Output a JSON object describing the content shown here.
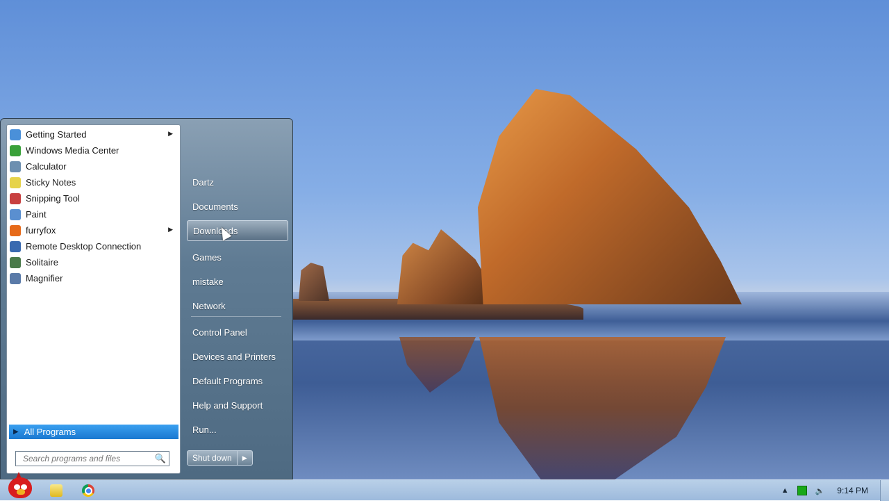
{
  "start_menu": {
    "programs": [
      {
        "label": "Getting Started",
        "icon": "getting-started-icon",
        "color": "#4a90d9",
        "has_submenu": true
      },
      {
        "label": "Windows Media Center",
        "icon": "media-center-icon",
        "color": "#3aa13a",
        "has_submenu": false
      },
      {
        "label": "Calculator",
        "icon": "calculator-icon",
        "color": "#6d8fb0",
        "has_submenu": false
      },
      {
        "label": "Sticky Notes",
        "icon": "sticky-notes-icon",
        "color": "#e6d34a",
        "has_submenu": false
      },
      {
        "label": "Snipping Tool",
        "icon": "snipping-tool-icon",
        "color": "#c84040",
        "has_submenu": false
      },
      {
        "label": "Paint",
        "icon": "paint-icon",
        "color": "#5a8fd0",
        "has_submenu": false
      },
      {
        "label": "furryfox",
        "icon": "firefox-icon",
        "color": "#e66a1a",
        "has_submenu": true
      },
      {
        "label": "Remote Desktop Connection",
        "icon": "remote-desktop-icon",
        "color": "#3a6ab0",
        "has_submenu": false
      },
      {
        "label": "Solitaire",
        "icon": "solitaire-icon",
        "color": "#4a7a4a",
        "has_submenu": false
      },
      {
        "label": "Magnifier",
        "icon": "magnifier-icon",
        "color": "#5a7aa8",
        "has_submenu": false
      }
    ],
    "all_programs_label": "All Programs",
    "search_placeholder": "Search programs and files",
    "places": [
      {
        "label": "Dartz"
      },
      {
        "label": "Documents"
      },
      {
        "label": "Downloads"
      },
      {
        "label": "Games"
      },
      {
        "label": "mistake"
      },
      {
        "label": "Network"
      },
      {
        "label": "Control Panel"
      },
      {
        "label": "Devices and Printers"
      },
      {
        "label": "Default Programs"
      },
      {
        "label": "Help and Support"
      },
      {
        "label": "Run..."
      }
    ],
    "hovered_place": "Downloads",
    "shutdown_label": "Shut down"
  },
  "taskbar": {
    "pinned": [
      "windows-explorer-icon",
      "chrome-icon"
    ],
    "clock": "9:14 PM"
  }
}
